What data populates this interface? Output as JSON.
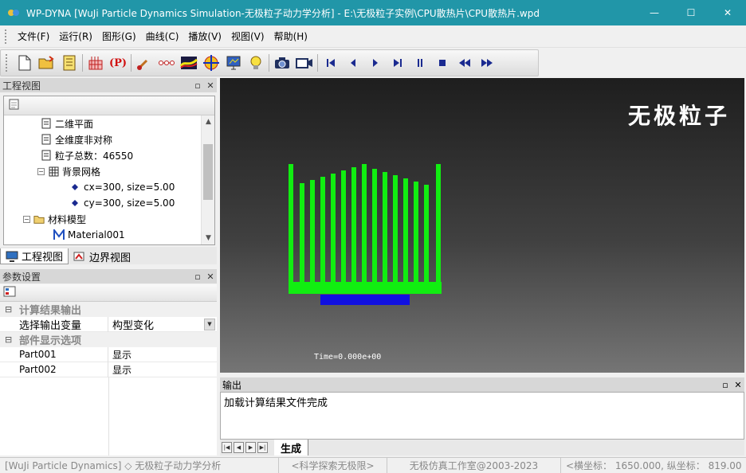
{
  "window": {
    "title": "WP-DYNA [WuJi Particle Dynamics Simulation-无极粒子动力学分析] - E:\\无极粒子实例\\CPU散热片\\CPU散热片.wpd",
    "minimize": "—",
    "maximize": "☐",
    "close": "✕"
  },
  "menu": [
    {
      "label": "文件(F)"
    },
    {
      "label": "运行(R)"
    },
    {
      "label": "图形(G)"
    },
    {
      "label": "曲线(C)"
    },
    {
      "label": "播放(V)"
    },
    {
      "label": "视图(V)"
    },
    {
      "label": "帮助(H)"
    }
  ],
  "toolbar": {
    "param_label": "(P)"
  },
  "project_panel": {
    "title": "工程视图",
    "pin": "▫",
    "close": "✕",
    "tree": [
      {
        "label": "二维平面"
      },
      {
        "label": "全维度非对称"
      },
      {
        "label": "粒子总数：46550"
      },
      {
        "label": "背景网格"
      },
      {
        "label": "cx=300, size=5.00"
      },
      {
        "label": "cy=300, size=5.00"
      },
      {
        "label": "材料模型"
      },
      {
        "label": "Material001"
      }
    ],
    "tabs": [
      {
        "label": "工程视图"
      },
      {
        "label": "边界视图"
      }
    ]
  },
  "params_panel": {
    "title": "参数设置",
    "pin": "▫",
    "close": "✕",
    "category1": "计算结果输出",
    "row1_name": "选择输出变量",
    "row1_value": "构型变化",
    "category2": "部件显示选项",
    "parts": [
      {
        "name": "Part001",
        "value": "显示"
      },
      {
        "name": "Part002",
        "value": "显示"
      }
    ]
  },
  "viewport": {
    "brand": "无极粒子",
    "time": "Time=0.000e+00",
    "colors": {
      "fins": "#11ee11",
      "base": "#1010e0"
    }
  },
  "output": {
    "title": "输出",
    "pin": "▫",
    "close": "✕",
    "message": "加载计算结果文件完成",
    "tab": "生成"
  },
  "status": [
    {
      "text": "[WuJi Particle Dynamics] ◇ 无极粒子动力学分析"
    },
    {
      "text": "<科学探索无极限>"
    },
    {
      "text": "无极仿真工作室@2003-2023"
    },
    {
      "text": "<横坐标：  1650.000,  纵坐标：  819.00"
    }
  ]
}
